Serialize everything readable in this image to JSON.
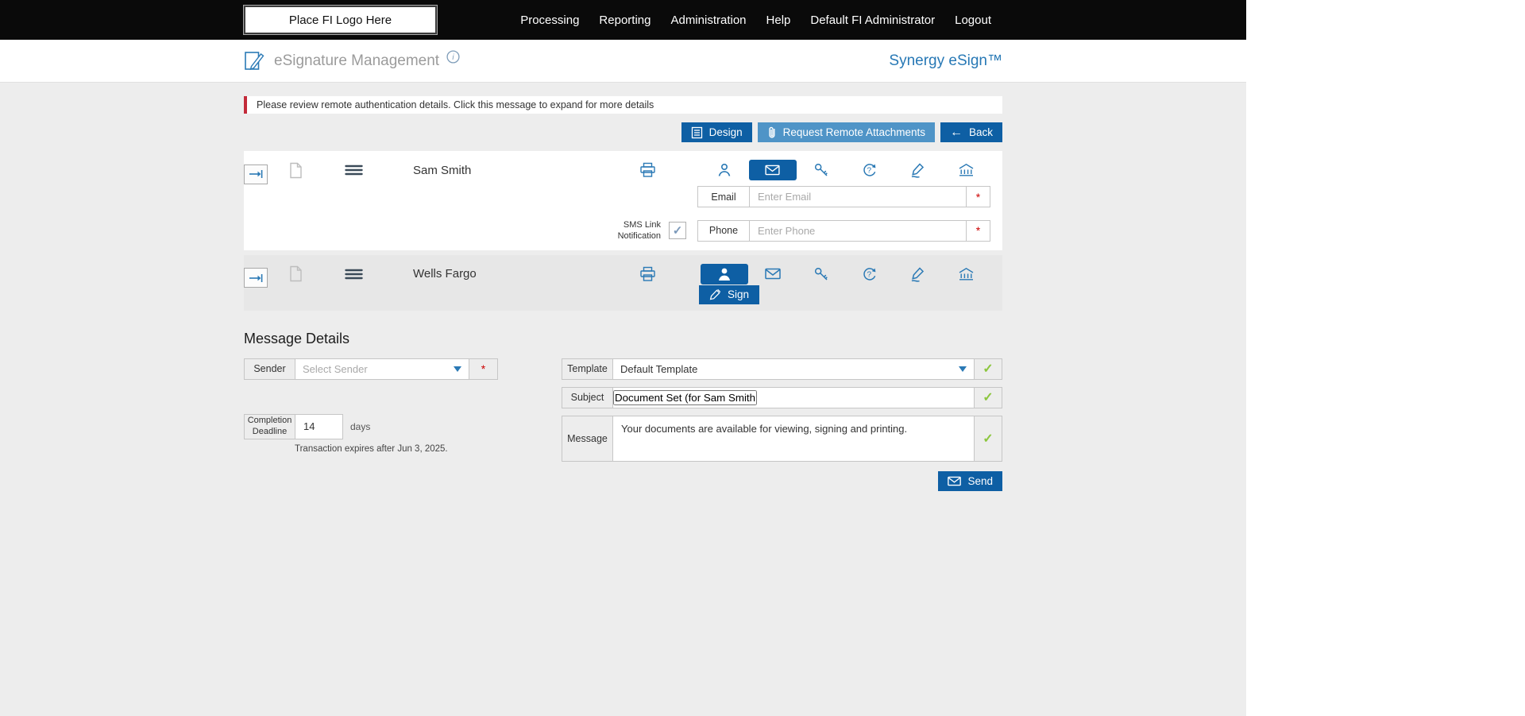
{
  "topbar": {
    "logo_text": "Place FI Logo Here",
    "nav": [
      {
        "label": "Processing"
      },
      {
        "label": "Reporting"
      },
      {
        "label": "Administration"
      },
      {
        "label": "Help"
      },
      {
        "label": "Default FI Administrator"
      },
      {
        "label": "Logout"
      }
    ]
  },
  "header": {
    "title": "eSignature Management",
    "brand": "Synergy eSign™"
  },
  "notification": {
    "text": "Please review remote authentication details. Click this message to expand for more details"
  },
  "toolbar": {
    "design_label": "Design",
    "request_label": "Request Remote Attachments",
    "back_label": "Back"
  },
  "recipients": [
    {
      "name": "Sam Smith",
      "selected_method": "remote-email",
      "email_label": "Email",
      "email_placeholder": "Enter Email",
      "sms_label": "SMS Link Notification",
      "sms_checked": true,
      "phone_label": "Phone",
      "phone_placeholder": "Enter Phone"
    },
    {
      "name": "Wells Fargo",
      "selected_method": "in-person",
      "sign_label": "Sign"
    }
  ],
  "message_details": {
    "heading": "Message Details",
    "sender_label": "Sender",
    "sender_placeholder": "Select Sender",
    "deadline_label": "Completion Deadline",
    "deadline_value": "14",
    "deadline_unit": "days",
    "expiry_note": "Transaction expires after Jun 3, 2025.",
    "template_label": "Template",
    "template_value": "Default Template",
    "subject_label": "Subject",
    "subject_value": "Document Set (for Sam Smith)",
    "message_label": "Message",
    "message_value": "Your documents are available for viewing, signing and printing.",
    "send_label": "Send"
  },
  "icons": {
    "back_arrow": "←",
    "check": "✓",
    "checkbox_check": "✓",
    "required_mark": "*"
  },
  "colors": {
    "topbar_bg": "#0a0a0a",
    "accent_dark_blue": "#0e5fa4",
    "accent_light_blue": "#4f94c7",
    "icon_blue": "#2a79b5",
    "brand_blue": "#2778b5",
    "success_green": "#8cc63e",
    "alert_red": "#c32b3a",
    "content_bg": "#ededed"
  }
}
